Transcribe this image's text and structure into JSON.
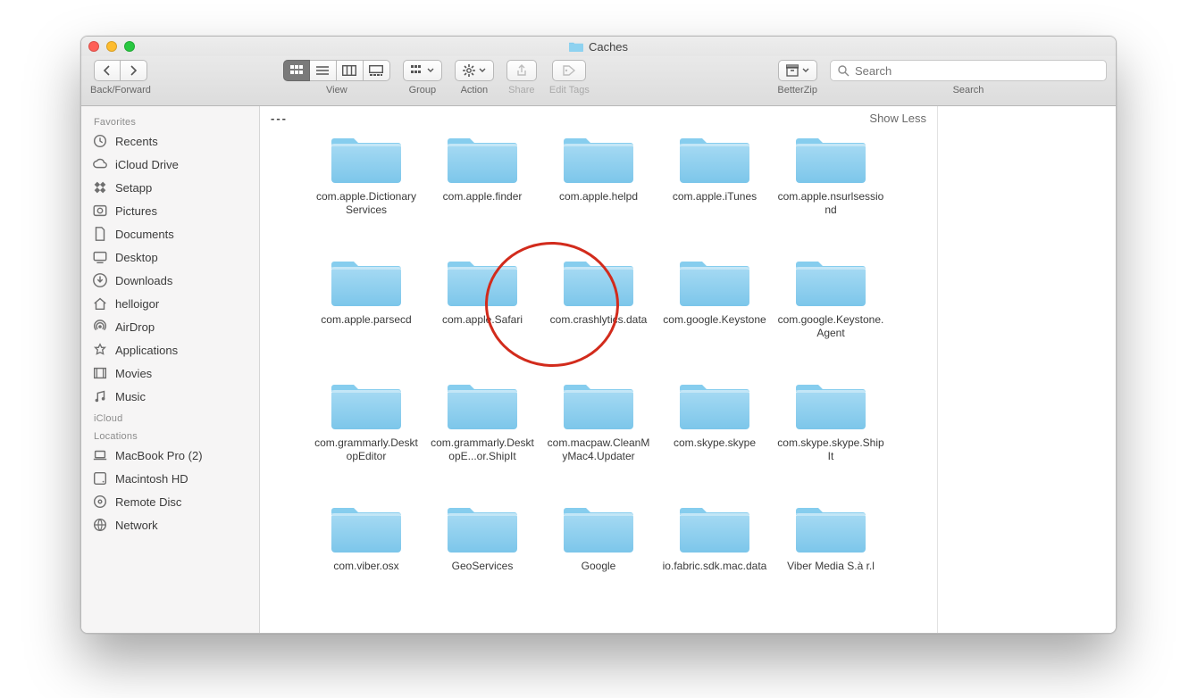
{
  "title": "Caches",
  "toolbar": {
    "backforward_label": "Back/Forward",
    "view_label": "View",
    "group_label": "Group",
    "action_label": "Action",
    "share_label": "Share",
    "edittags_label": "Edit Tags",
    "betterzip_label": "BetterZip",
    "search_label": "Search",
    "search_placeholder": "Search"
  },
  "sidebar": {
    "favorites_head": "Favorites",
    "items": [
      {
        "icon": "recents",
        "label": "Recents"
      },
      {
        "icon": "icloud",
        "label": "iCloud Drive"
      },
      {
        "icon": "setapp",
        "label": "Setapp"
      },
      {
        "icon": "pictures",
        "label": "Pictures"
      },
      {
        "icon": "documents",
        "label": "Documents"
      },
      {
        "icon": "desktop",
        "label": "Desktop"
      },
      {
        "icon": "downloads",
        "label": "Downloads"
      },
      {
        "icon": "home",
        "label": "helloigor"
      },
      {
        "icon": "airdrop",
        "label": "AirDrop"
      },
      {
        "icon": "applications",
        "label": "Applications"
      },
      {
        "icon": "movies",
        "label": "Movies"
      },
      {
        "icon": "music",
        "label": "Music"
      }
    ],
    "icloud_head": "iCloud",
    "locations_head": "Locations",
    "locations": [
      {
        "icon": "laptop",
        "label": "MacBook Pro (2)"
      },
      {
        "icon": "hdd",
        "label": "Macintosh HD"
      },
      {
        "icon": "remotedisc",
        "label": "Remote Disc"
      },
      {
        "icon": "network",
        "label": "Network"
      }
    ]
  },
  "infobar": {
    "path": "---",
    "showless": "Show Less"
  },
  "folders": [
    "com.apple.DictionaryServices",
    "com.apple.finder",
    "com.apple.helpd",
    "com.apple.iTunes",
    "com.apple.nsurlsessiond",
    "com.apple.parsecd",
    "com.apple.Safari",
    "com.crashlytics.data",
    "com.google.Keystone",
    "com.google.Keystone.Agent",
    "com.grammarly.DesktopEditor",
    "com.grammarly.DesktopE...or.ShipIt",
    "com.macpaw.CleanMyMac4.Updater",
    "com.skype.skype",
    "com.skype.skype.ShipIt",
    "com.viber.osx",
    "GeoServices",
    "Google",
    "io.fabric.sdk.mac.data",
    "Viber Media S.à r.l"
  ],
  "annotation": {
    "highlighted_index": 6
  }
}
